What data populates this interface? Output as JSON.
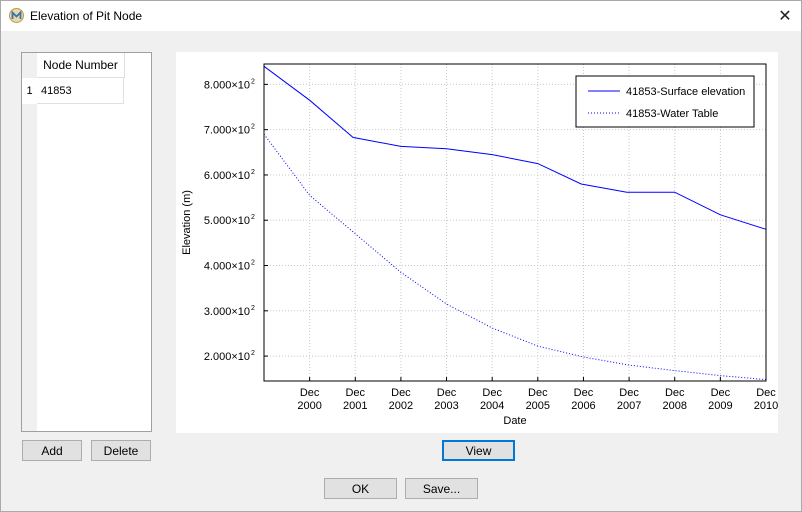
{
  "window": {
    "title": "Elevation of Pit Node",
    "close_glyph": "✕",
    "icon": "app-logo-icon"
  },
  "table": {
    "column_header": "Node Number",
    "rows": [
      {
        "num": "1",
        "node": "41853"
      }
    ]
  },
  "buttons": {
    "add": "Add",
    "delete": "Delete",
    "view": "View",
    "ok": "OK",
    "save": "Save..."
  },
  "chart_data": {
    "type": "line",
    "ylabel": "Elevation (m)",
    "xlabel": "Date",
    "ylim": [
      145,
      845
    ],
    "xlim": [
      1999.0,
      2010.0
    ],
    "x_ticks": [
      {
        "month": "Dec",
        "year": "2000"
      },
      {
        "month": "Dec",
        "year": "2001"
      },
      {
        "month": "Dec",
        "year": "2002"
      },
      {
        "month": "Dec",
        "year": "2003"
      },
      {
        "month": "Dec",
        "year": "2004"
      },
      {
        "month": "Dec",
        "year": "2005"
      },
      {
        "month": "Dec",
        "year": "2006"
      },
      {
        "month": "Dec",
        "year": "2007"
      },
      {
        "month": "Dec",
        "year": "2008"
      },
      {
        "month": "Dec",
        "year": "2009"
      },
      {
        "month": "Dec",
        "year": "2010"
      }
    ],
    "y_ticks": [
      {
        "value": 200,
        "mantissa": "2.000×10",
        "exp": "2"
      },
      {
        "value": 300,
        "mantissa": "3.000×10",
        "exp": "2"
      },
      {
        "value": 400,
        "mantissa": "4.000×10",
        "exp": "2"
      },
      {
        "value": 500,
        "mantissa": "5.000×10",
        "exp": "2"
      },
      {
        "value": 600,
        "mantissa": "6.000×10",
        "exp": "2"
      },
      {
        "value": 700,
        "mantissa": "7.000×10",
        "exp": "2"
      },
      {
        "value": 800,
        "mantissa": "8.000×10",
        "exp": "2"
      }
    ],
    "grid": true,
    "legend_position": "top-right",
    "series": [
      {
        "name": "41853-Surface elevation",
        "color": "#0000ff",
        "style": "solid",
        "x": [
          1999.0,
          2000.0,
          2000.95,
          2002.0,
          2003.0,
          2004.0,
          2005.0,
          2005.95,
          2006.95,
          2008.0,
          2009.0,
          2010.0
        ],
        "y": [
          840,
          765,
          683,
          663,
          658,
          645,
          625,
          580,
          562,
          562,
          512,
          480
        ]
      },
      {
        "name": "41853-Water Table",
        "color": "#0000ff",
        "style": "dotted",
        "x": [
          1999.0,
          2000.0,
          2001.0,
          2002.0,
          2003.0,
          2004.0,
          2005.0,
          2006.0,
          2007.0,
          2008.0,
          2009.0,
          2010.0
        ],
        "y": [
          690,
          555,
          470,
          385,
          315,
          262,
          222,
          198,
          180,
          168,
          157,
          148
        ]
      }
    ]
  }
}
